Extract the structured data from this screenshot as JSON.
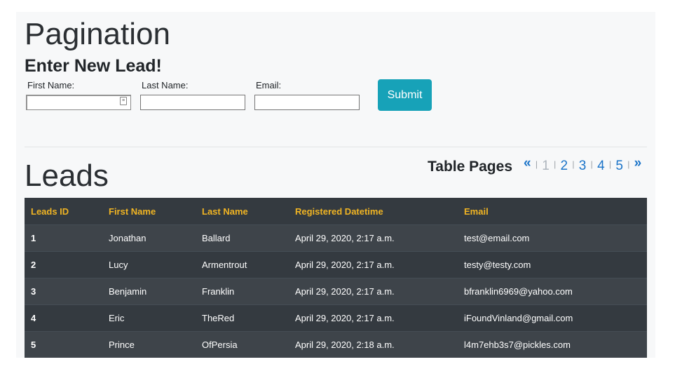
{
  "page": {
    "title": "Pagination"
  },
  "form": {
    "title": "Enter New Lead!",
    "first_name_label": "First Name:",
    "first_name_value": "",
    "last_name_label": "Last Name:",
    "last_name_value": "",
    "email_label": "Email:",
    "email_value": "",
    "submit_label": "Submit"
  },
  "leads": {
    "title": "Leads",
    "pager": {
      "label": "Table Pages",
      "first": "«",
      "last": "»",
      "separator": "|",
      "pages": [
        "1",
        "2",
        "3",
        "4",
        "5"
      ],
      "current_page": "1"
    },
    "table": {
      "headers": [
        "Leads ID",
        "First Name",
        "Last Name",
        "Registered Datetime",
        "Email"
      ],
      "rows": [
        [
          "1",
          "Jonathan",
          "Ballard",
          "April 29, 2020, 2:17 a.m.",
          "test@email.com"
        ],
        [
          "2",
          "Lucy",
          "Armentrout",
          "April 29, 2020, 2:17 a.m.",
          "testy@testy.com"
        ],
        [
          "3",
          "Benjamin",
          "Franklin",
          "April 29, 2020, 2:17 a.m.",
          "bfranklin6969@yahoo.com"
        ],
        [
          "4",
          "Eric",
          "TheRed",
          "April 29, 2020, 2:17 a.m.",
          "iFoundVinland@gmail.com"
        ],
        [
          "5",
          "Prince",
          "OfPersia",
          "April 29, 2020, 2:18 a.m.",
          "l4m7ehb3s7@pickles.com"
        ]
      ]
    }
  },
  "colors": {
    "header_text": "#f0b423",
    "table_bg": "#343a40",
    "submit_bg": "#17a2b8",
    "link": "#1a73c8"
  }
}
